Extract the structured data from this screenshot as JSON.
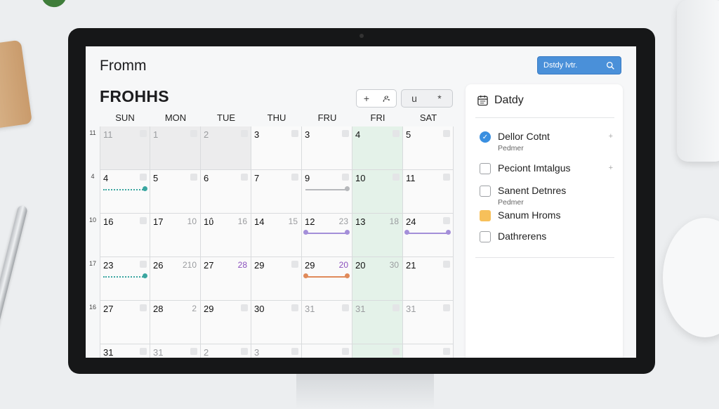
{
  "app": {
    "title": "Fromm",
    "month_title": "FROHHS"
  },
  "search": {
    "label": "Dstdy lvtr.",
    "icon": "search-icon",
    "accent": "#4a90d9"
  },
  "toolbar": {
    "group1": [
      {
        "label": "+",
        "icon": "plus-icon"
      },
      {
        "label": "ዶ",
        "icon": "person-icon"
      }
    ],
    "group2": [
      {
        "label": "u",
        "icon": "view-icon"
      },
      {
        "label": "*",
        "icon": "settings-icon"
      }
    ]
  },
  "calendar": {
    "day_headers": [
      "SUN",
      "MON",
      "TUE",
      "THU",
      "FRU",
      "FRI",
      "SAT"
    ],
    "weeks": [
      {
        "week_no": "11",
        "days": [
          {
            "n": "11",
            "faint": true,
            "shade": true
          },
          {
            "n": "1",
            "faint": true,
            "shade": true
          },
          {
            "n": "2",
            "faint": true,
            "shade": true
          },
          {
            "n": "3"
          },
          {
            "n": "3"
          },
          {
            "n": "4",
            "green": true
          },
          {
            "n": "5"
          }
        ]
      },
      {
        "week_no": "4",
        "days": [
          {
            "n": "4"
          },
          {
            "n": "5"
          },
          {
            "n": "6"
          },
          {
            "n": "7"
          },
          {
            "n": "9"
          },
          {
            "n": "10",
            "green": true
          },
          {
            "n": "11"
          }
        ]
      },
      {
        "week_no": "10",
        "days": [
          {
            "n": "16"
          },
          {
            "n": "17",
            "alt": "10"
          },
          {
            "n": "1ΰ",
            "alt": "16"
          },
          {
            "n": "14",
            "alt": "15"
          },
          {
            "n": "12",
            "alt": "23"
          },
          {
            "n": "13",
            "alt": "18",
            "green": true
          },
          {
            "n": "24"
          }
        ]
      },
      {
        "week_no": "17",
        "days": [
          {
            "n": "23"
          },
          {
            "n": "26",
            "alt": "210"
          },
          {
            "n": "27",
            "alt": "28",
            "alt_purple": true
          },
          {
            "n": "29"
          },
          {
            "n": "29",
            "alt": "20",
            "alt_purple": true
          },
          {
            "n": "20",
            "alt": "30",
            "green": true
          },
          {
            "n": "21"
          }
        ]
      },
      {
        "week_no": "16",
        "days": [
          {
            "n": "27"
          },
          {
            "n": "28",
            "alt": "2"
          },
          {
            "n": "29"
          },
          {
            "n": "30"
          },
          {
            "n": "31",
            "faint": true
          },
          {
            "n": "31",
            "faint": true,
            "green": true
          },
          {
            "n": "31",
            "faint": true
          }
        ]
      },
      {
        "week_no": "",
        "days": [
          {
            "n": "31"
          },
          {
            "n": "31",
            "faint": true
          },
          {
            "n": "2",
            "faint": true
          },
          {
            "n": "3",
            "faint": true
          },
          {
            "n": ""
          },
          {
            "n": "",
            "green": true
          },
          {
            "n": ""
          }
        ]
      }
    ],
    "events": [
      {
        "week": 1,
        "from_col": 0,
        "to_col": 0,
        "color": "#3aa6a0",
        "style": "dotted"
      },
      {
        "week": 1,
        "from_col": 4,
        "to_col": 4,
        "color": "#b7b9bc",
        "style": "solid"
      },
      {
        "week": 2,
        "from_col": 4,
        "to_col": 4,
        "color": "#a48fd9",
        "style": "solid"
      },
      {
        "week": 2,
        "from_col": 6,
        "to_col": 6,
        "color": "#a48fd9",
        "style": "solid"
      },
      {
        "week": 3,
        "from_col": 0,
        "to_col": 0,
        "color": "#3aa6a0",
        "style": "dotted"
      },
      {
        "week": 3,
        "from_col": 4,
        "to_col": 4,
        "color": "#e08a5a",
        "style": "solid"
      }
    ]
  },
  "panel": {
    "title": "Datdy",
    "icon": "calendar-icon",
    "tasks": [
      {
        "label": "Dellor Cotnt",
        "sub": "Pedmer",
        "state": "done",
        "mark": "+"
      },
      {
        "label": "Peciont Imtalgus",
        "sub": "",
        "state": "empty",
        "mark": "+"
      },
      {
        "label": "Sanent Detnres",
        "sub": "Pedmer",
        "state": "empty",
        "mark": ""
      },
      {
        "label": "Sanum Hroms",
        "sub": "",
        "state": "yellow",
        "mark": ""
      },
      {
        "label": "Dathrerens",
        "sub": "",
        "state": "empty",
        "mark": ""
      }
    ]
  }
}
